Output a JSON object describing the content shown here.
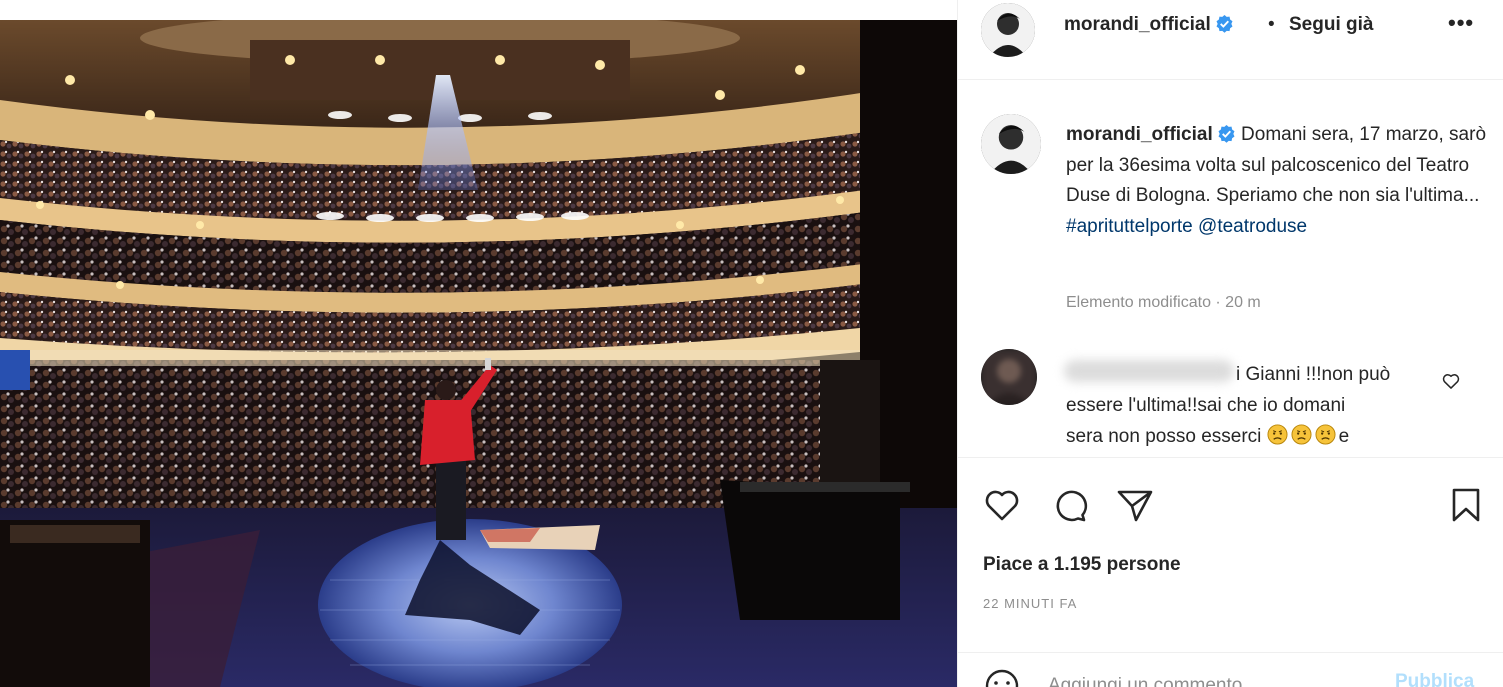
{
  "post": {
    "username": "morandi_official",
    "follow_separator": "•",
    "follow_label": "Segui già",
    "more_label": "•••",
    "photo_icon": "concert-photo"
  },
  "caption": {
    "username": "morandi_official",
    "text": "Domani sera, 17 marzo, sarò per la 36esima volta sul palcoscenico del Teatro Duse di Bologna. Speriamo che non sia l'ultima...",
    "hashtag": "#aprituttelporte",
    "mention": "@teatroduse",
    "meta": "Elemento modificato · 20 m"
  },
  "comment": {
    "line1": "i Gianni !!!non può",
    "line2": "essere l'ultima!!sai che io domani",
    "line3_prefix": "sera non posso esserci",
    "line3_suffix": "e",
    "emoji": "disappointed-face"
  },
  "actions": {
    "likes_text": "Piace a 1.195 persone",
    "time_text": "22 minuti fa"
  },
  "add_comment": {
    "placeholder": "Aggiungi un commento...",
    "publish_label": "Pubblica"
  },
  "colors": {
    "text": "#262626",
    "secondary": "#8e8e8e",
    "link": "#00376b",
    "verified": "#3897f0",
    "publish_disabled": "#b2dffc",
    "divider": "#efefef"
  }
}
